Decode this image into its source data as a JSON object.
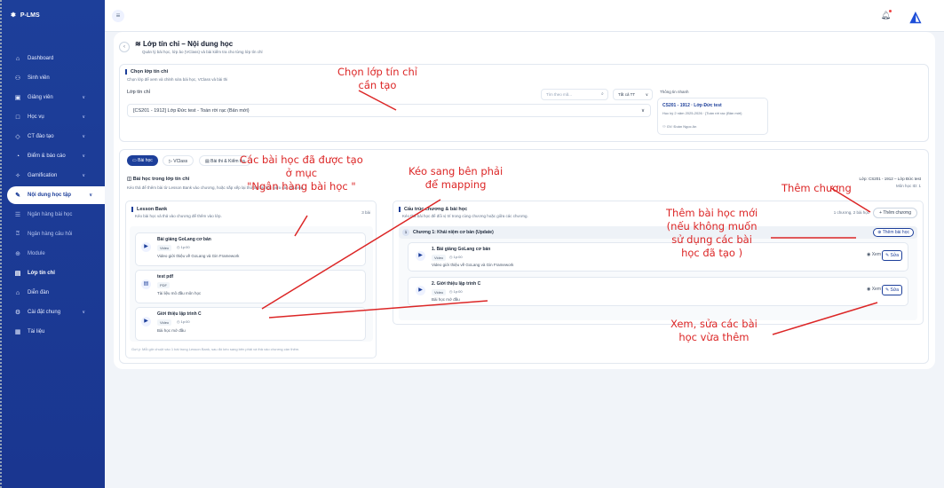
{
  "app": {
    "name": "P-LMS"
  },
  "sidebar": {
    "items": [
      {
        "label": "Dashboard",
        "icon": "home-icon"
      },
      {
        "label": "Sinh viên",
        "icon": "users-icon"
      },
      {
        "label": "Giảng viên",
        "icon": "id-card-icon"
      },
      {
        "label": "Học vụ",
        "icon": "book-icon"
      },
      {
        "label": "CT đào tạo",
        "icon": "graduation-cap-icon"
      },
      {
        "label": "Điểm & báo cáo",
        "icon": "chart-icon"
      },
      {
        "label": "Gamification",
        "icon": "sparkle-icon"
      },
      {
        "label": "Nội dung học tập",
        "icon": "pen-icon"
      },
      {
        "label": "Ngân hàng bài học",
        "icon": "list-icon"
      },
      {
        "label": "Ngân hàng câu hỏi",
        "icon": "question-icon"
      },
      {
        "label": "Module",
        "icon": "plus-circle-icon"
      },
      {
        "label": "Lớp tín chỉ",
        "icon": "class-icon"
      },
      {
        "label": "Diễn đàn",
        "icon": "forum-icon"
      },
      {
        "label": "Cài đặt chung",
        "icon": "gear-icon"
      },
      {
        "label": "Tài liệu",
        "icon": "document-icon"
      }
    ]
  },
  "header": {
    "title": "Lớp tín chỉ – Nội dung học",
    "subtitle": "Quản lý bài học, lớp ảo (VClass) và bài kiểm tra cho từng lớp tín chỉ"
  },
  "class_select": {
    "title": "Chọn lớp tín chỉ",
    "desc": "Chọn lớp để xem và chỉnh sửa bài học, VClass và bài thi",
    "label": "Lớp tín chỉ",
    "search_placeholder": "Tìm theo mã...",
    "status_filter": "Tất cả TT",
    "selected": "[CS201 - 1912] Lớp Đức test - Toán rời rạc (Bản mới)",
    "quick_info_title": "Thông tin nhanh",
    "quick_class": "CS201 - 1912 · Lớp Đức test",
    "quick_term": "Học kỳ 2 năm 2025-2026 · [Toán rời rạc (Bản mới)",
    "quick_teacher": "GV: Đoàn Ngọc An"
  },
  "tabs": [
    "Bài học",
    "VClass",
    "Bài thi & Kiểm tra"
  ],
  "lessons_section": {
    "title": "Bài học trong lớp tín chỉ",
    "desc": "Kéo thả để thêm bài từ Lesson Bank vào chương, hoặc sắp xếp lại thứ tự bài học giữa các chương.",
    "class_info": "Lớp: CS201 - 1912 – Lớp Đức test",
    "subject_id": "Môn học ID: 1"
  },
  "lesson_bank": {
    "title": "Lesson Bank",
    "desc": "Kéo bài học và thả vào chương để thêm vào lớp.",
    "count": "3 bài",
    "hint": "Gợi ý: Mỗi giờ chuột vào 1 bài trong Lesson Bank, sau đó kéo sang bên phải và thả vào chương cần thêm.",
    "items": [
      {
        "name": "Bài giảng GoLang cơ bản",
        "type": "Video",
        "duration": "1p:00",
        "desc": "Video giới thiệu về GoLang và Gin Framework"
      },
      {
        "name": "test pdf",
        "type": "PDF",
        "duration": "",
        "desc": "Tài liệu mô đầu môn học"
      },
      {
        "name": "Giới thiệu lập trình C",
        "type": "Video",
        "duration": "1p:00",
        "desc": "Bài học mở đầu"
      }
    ]
  },
  "structure": {
    "title": "Cấu trúc chương & bài học",
    "desc": "Kéo thả bài học để đổi vị trí trong cùng chương hoặc giữa các chương.",
    "count": "1 chương, 2 bài học",
    "add_chapter": "Thêm chương",
    "chapter_title": "Chương 1: Khái niệm cơ bản (Update)",
    "add_lesson": "Thêm bài học",
    "items": [
      {
        "name": "Bài giảng GoLang cơ bản",
        "order": "1",
        "type": "Video",
        "duration": "1p:00",
        "desc": "Video giới thiệu về GoLang và Gin Framework"
      },
      {
        "name": "Giới thiệu lập trình C",
        "order": "2",
        "type": "Video",
        "duration": "1p:00",
        "desc": "Bài học mở đầu"
      }
    ],
    "view_label": "Xem",
    "edit_label": "Sửa"
  },
  "annotations": {
    "choose_class": [
      "Chọn lớp tín chỉ",
      "cần tạo"
    ],
    "bank": [
      "Các bài học đã được tạo",
      "ở mục",
      "\"Ngân hàng bài học \""
    ],
    "drag": [
      "Kéo sang bên phải",
      "để mapping"
    ],
    "add_chapter": [
      "Thêm chương"
    ],
    "add_lesson": [
      "Thêm bài học mới",
      "(nếu không muốn",
      "sử dụng các bài",
      "học đã tạo )"
    ],
    "view_edit": [
      "Xem, sửa các bài",
      "học vừa thêm"
    ]
  },
  "colors": {
    "primary": "#1d3f9a",
    "annotation": "#dc2626"
  }
}
